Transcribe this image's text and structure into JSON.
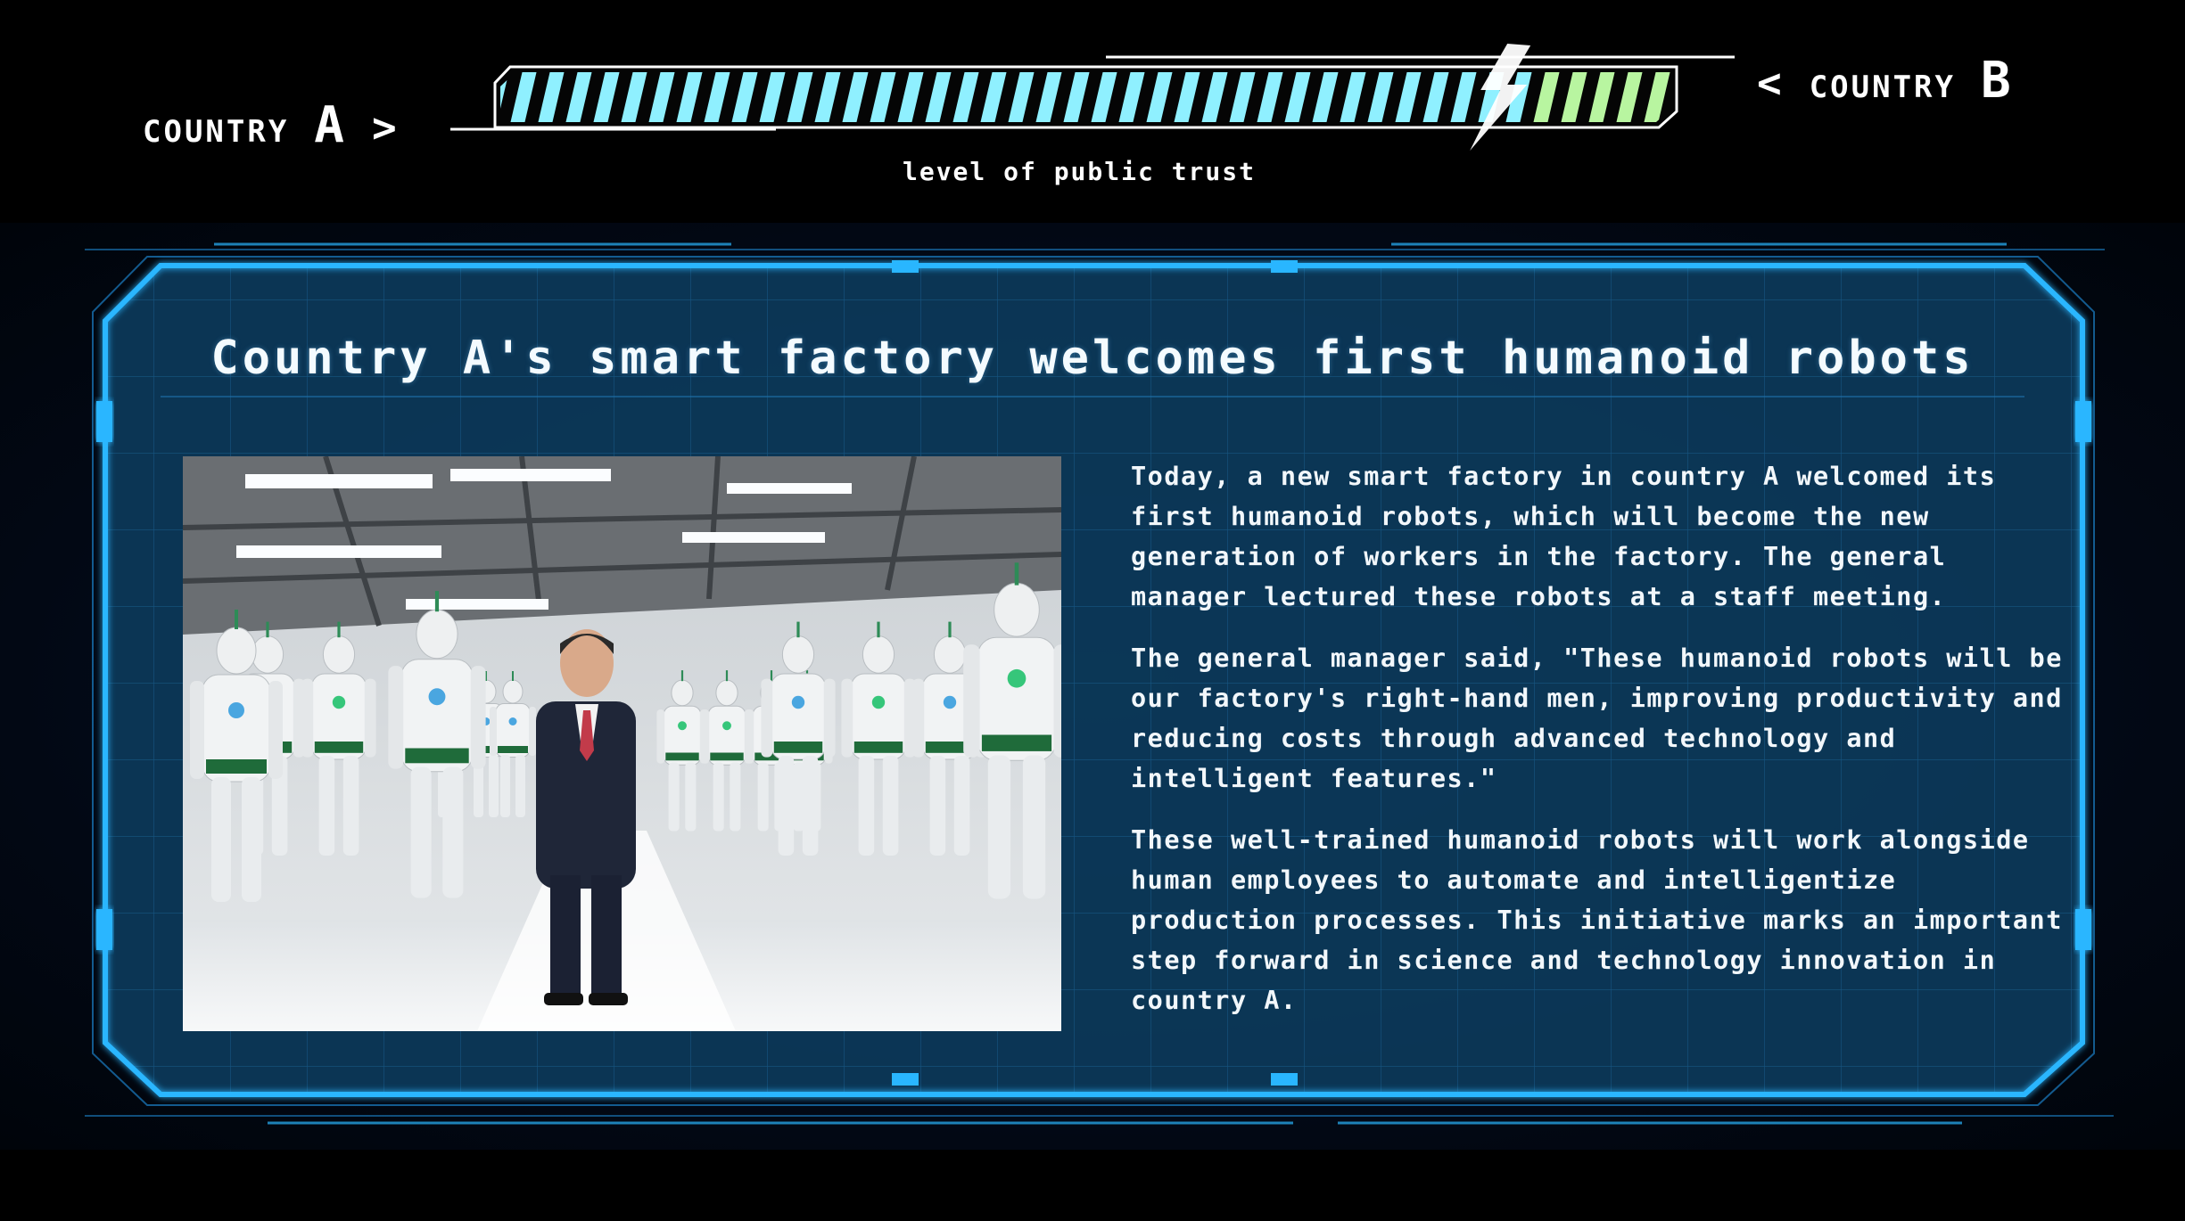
{
  "hud": {
    "left": {
      "word": "COUNTRY",
      "letter": "A",
      "arrow": ">"
    },
    "right": {
      "arrow": "<",
      "word": "COUNTRY",
      "letter": "B"
    },
    "trust_label": "level of public trust",
    "trust_share": {
      "country_a": 0.86,
      "country_b": 0.14
    },
    "colors": {
      "country_a": "#8ff0ff",
      "country_b": "#b8f5a0"
    }
  },
  "article": {
    "headline": "Country A's smart factory welcomes first humanoid robots",
    "paragraphs": [
      "Today, a new smart factory in country A welcomed its first humanoid robots, which will become the new generation of workers in the factory. The general manager lectured these robots at a staff meeting.",
      "The general manager said, \"These humanoid robots will be our factory's right-hand men, improving productivity and reducing costs through advanced technology and intelligent features.\"",
      "These well-trained humanoid robots will work alongside human employees to automate and intelligentize production processes. This initiative marks an important step forward in science and technology innovation in country A."
    ],
    "frame_color": "#1fa8ff"
  }
}
